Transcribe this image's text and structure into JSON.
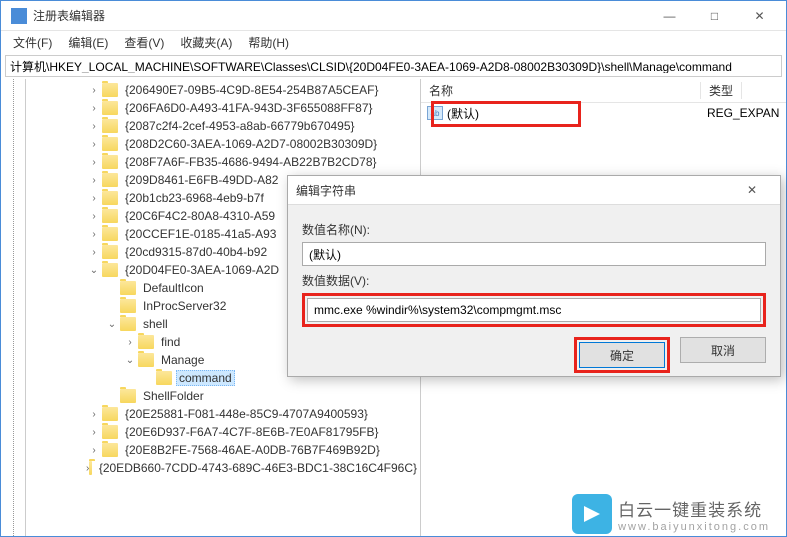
{
  "window": {
    "title": "注册表编辑器",
    "min": "—",
    "max": "□",
    "close": "✕"
  },
  "menu": {
    "file": "文件(F)",
    "edit": "编辑(E)",
    "view": "查看(V)",
    "favorites": "收藏夹(A)",
    "help": "帮助(H)"
  },
  "address": "计算机\\HKEY_LOCAL_MACHINE\\SOFTWARE\\Classes\\CLSID\\{20D04FE0-3AEA-1069-A2D8-08002B30309D}\\shell\\Manage\\command",
  "tree": [
    {
      "ind": 1,
      "t": ">",
      "label": "{206490E7-09B5-4C9D-8E54-254B87A5CEAF}"
    },
    {
      "ind": 1,
      "t": ">",
      "label": "{206FA6D0-A493-41FA-943D-3F655088FF87}"
    },
    {
      "ind": 1,
      "t": ">",
      "label": "{2087c2f4-2cef-4953-a8ab-66779b670495}"
    },
    {
      "ind": 1,
      "t": ">",
      "label": "{208D2C60-3AEA-1069-A2D7-08002B30309D}"
    },
    {
      "ind": 1,
      "t": ">",
      "label": "{208F7A6F-FB35-4686-9494-AB22B7B2CD78}"
    },
    {
      "ind": 1,
      "t": ">",
      "label": "{209D8461-E6FB-49DD-A82"
    },
    {
      "ind": 1,
      "t": ">",
      "label": "{20b1cb23-6968-4eb9-b7f"
    },
    {
      "ind": 1,
      "t": ">",
      "label": "{20C6F4C2-80A8-4310-A59"
    },
    {
      "ind": 1,
      "t": ">",
      "label": "{20CCEF1E-0185-41a5-A93"
    },
    {
      "ind": 1,
      "t": ">",
      "label": "{20cd9315-87d0-40b4-b92"
    },
    {
      "ind": 1,
      "t": "v",
      "label": "{20D04FE0-3AEA-1069-A2D"
    },
    {
      "ind": 2,
      "t": "",
      "label": "DefaultIcon"
    },
    {
      "ind": 2,
      "t": "",
      "label": "InProcServer32"
    },
    {
      "ind": 2,
      "t": "v",
      "label": "shell"
    },
    {
      "ind": 3,
      "t": ">",
      "label": "find"
    },
    {
      "ind": 3,
      "t": "v",
      "label": "Manage"
    },
    {
      "ind": 4,
      "t": "",
      "label": "command",
      "selected": true
    },
    {
      "ind": 2,
      "t": "",
      "label": "ShellFolder"
    },
    {
      "ind": 1,
      "t": ">",
      "label": "{20E25881-F081-448e-85C9-4707A9400593}"
    },
    {
      "ind": 1,
      "t": ">",
      "label": "{20E6D937-F6A7-4C7F-8E6B-7E0AF81795FB}"
    },
    {
      "ind": 1,
      "t": ">",
      "label": "{20E8B2FE-7568-46AE-A0DB-76B7F469B92D}"
    },
    {
      "ind": 1,
      "t": ">",
      "label": "{20EDB660-7CDD-4743-689C-46E3-BDC1-38C16C4F96C}"
    }
  ],
  "list": {
    "header_name": "名称",
    "header_type": "类型",
    "row_name": "(默认)",
    "row_type": "REG_EXPAN",
    "reg_ab": "ab"
  },
  "dialog": {
    "title": "编辑字符串",
    "close": "✕",
    "name_label": "数值名称(N):",
    "name_value": "(默认)",
    "data_label": "数值数据(V):",
    "data_value": "mmc.exe %windir%\\system32\\compmgmt.msc",
    "ok": "确定",
    "cancel": "取消"
  },
  "watermark": {
    "line1": "白云一键重装系统",
    "line2": "www.baiyunxitong.com"
  },
  "chart_data": null
}
